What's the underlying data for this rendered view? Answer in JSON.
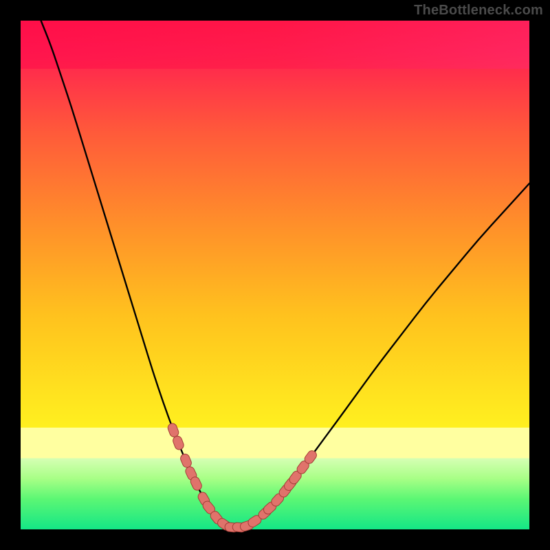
{
  "watermark": "TheBottleneck.com",
  "colors": {
    "frame": "#000000",
    "curve": "#000000",
    "marker_fill": "#e0736b",
    "marker_stroke": "#a23c36",
    "gradient_top": "#ff1a4b",
    "gradient_mid": "#ffd21a",
    "gradient_green_light": "#b7ff6e",
    "gradient_green": "#2af070",
    "gradient_green_deep": "#16e884"
  },
  "chart_data": {
    "type": "line",
    "title": "",
    "xlabel": "",
    "ylabel": "",
    "xlim": [
      0,
      100
    ],
    "ylim": [
      0,
      100
    ],
    "description": "Bottleneck curve: a V-shaped curve over a vertical red→yellow→green gradient. Curve minimum is near zero around x≈40. Salmon pill-shaped markers cluster on both flanks of the valley in the lower (green/yellow) band. Y is percentage-like bottleneck; X is an unlabeled configuration axis.",
    "curve_points": [
      {
        "x": 4.0,
        "y": 100.0
      },
      {
        "x": 6.0,
        "y": 95.0
      },
      {
        "x": 8.0,
        "y": 89.0
      },
      {
        "x": 10.0,
        "y": 83.0
      },
      {
        "x": 12.0,
        "y": 76.5
      },
      {
        "x": 14.0,
        "y": 70.0
      },
      {
        "x": 16.0,
        "y": 63.5
      },
      {
        "x": 18.0,
        "y": 57.0
      },
      {
        "x": 20.0,
        "y": 50.5
      },
      {
        "x": 22.0,
        "y": 44.0
      },
      {
        "x": 24.0,
        "y": 37.5
      },
      {
        "x": 26.0,
        "y": 31.0
      },
      {
        "x": 28.0,
        "y": 25.0
      },
      {
        "x": 30.0,
        "y": 19.5
      },
      {
        "x": 32.0,
        "y": 14.5
      },
      {
        "x": 34.0,
        "y": 10.0
      },
      {
        "x": 36.0,
        "y": 6.0
      },
      {
        "x": 38.0,
        "y": 3.0
      },
      {
        "x": 40.0,
        "y": 1.0
      },
      {
        "x": 42.0,
        "y": 0.3
      },
      {
        "x": 44.0,
        "y": 0.6
      },
      {
        "x": 46.0,
        "y": 1.6
      },
      {
        "x": 48.0,
        "y": 3.2
      },
      {
        "x": 50.0,
        "y": 5.2
      },
      {
        "x": 52.0,
        "y": 7.6
      },
      {
        "x": 55.0,
        "y": 11.5
      },
      {
        "x": 58.0,
        "y": 15.6
      },
      {
        "x": 62.0,
        "y": 21.0
      },
      {
        "x": 66.0,
        "y": 26.5
      },
      {
        "x": 70.0,
        "y": 32.0
      },
      {
        "x": 75.0,
        "y": 38.5
      },
      {
        "x": 80.0,
        "y": 45.0
      },
      {
        "x": 85.0,
        "y": 51.0
      },
      {
        "x": 90.0,
        "y": 57.0
      },
      {
        "x": 95.0,
        "y": 62.5
      },
      {
        "x": 100.0,
        "y": 68.0
      }
    ],
    "markers_left": [
      {
        "x": 30.0,
        "y": 19.5
      },
      {
        "x": 31.0,
        "y": 17.0
      },
      {
        "x": 32.5,
        "y": 13.5
      },
      {
        "x": 33.5,
        "y": 11.0
      },
      {
        "x": 34.5,
        "y": 9.0
      },
      {
        "x": 36.0,
        "y": 6.0
      },
      {
        "x": 37.0,
        "y": 4.3
      },
      {
        "x": 38.5,
        "y": 2.3
      }
    ],
    "markers_bottom": [
      {
        "x": 40.0,
        "y": 1.0
      },
      {
        "x": 41.5,
        "y": 0.4
      },
      {
        "x": 43.0,
        "y": 0.4
      },
      {
        "x": 44.5,
        "y": 0.7
      },
      {
        "x": 46.0,
        "y": 1.6
      }
    ],
    "markers_right": [
      {
        "x": 48.0,
        "y": 3.2
      },
      {
        "x": 49.0,
        "y": 4.2
      },
      {
        "x": 50.5,
        "y": 5.8
      },
      {
        "x": 52.0,
        "y": 7.6
      },
      {
        "x": 53.0,
        "y": 8.9
      },
      {
        "x": 54.0,
        "y": 10.2
      },
      {
        "x": 55.5,
        "y": 12.2
      },
      {
        "x": 57.0,
        "y": 14.2
      }
    ],
    "green_band_y_range": [
      0,
      16
    ],
    "pale_yellow_band_y_range": [
      16,
      22
    ]
  }
}
